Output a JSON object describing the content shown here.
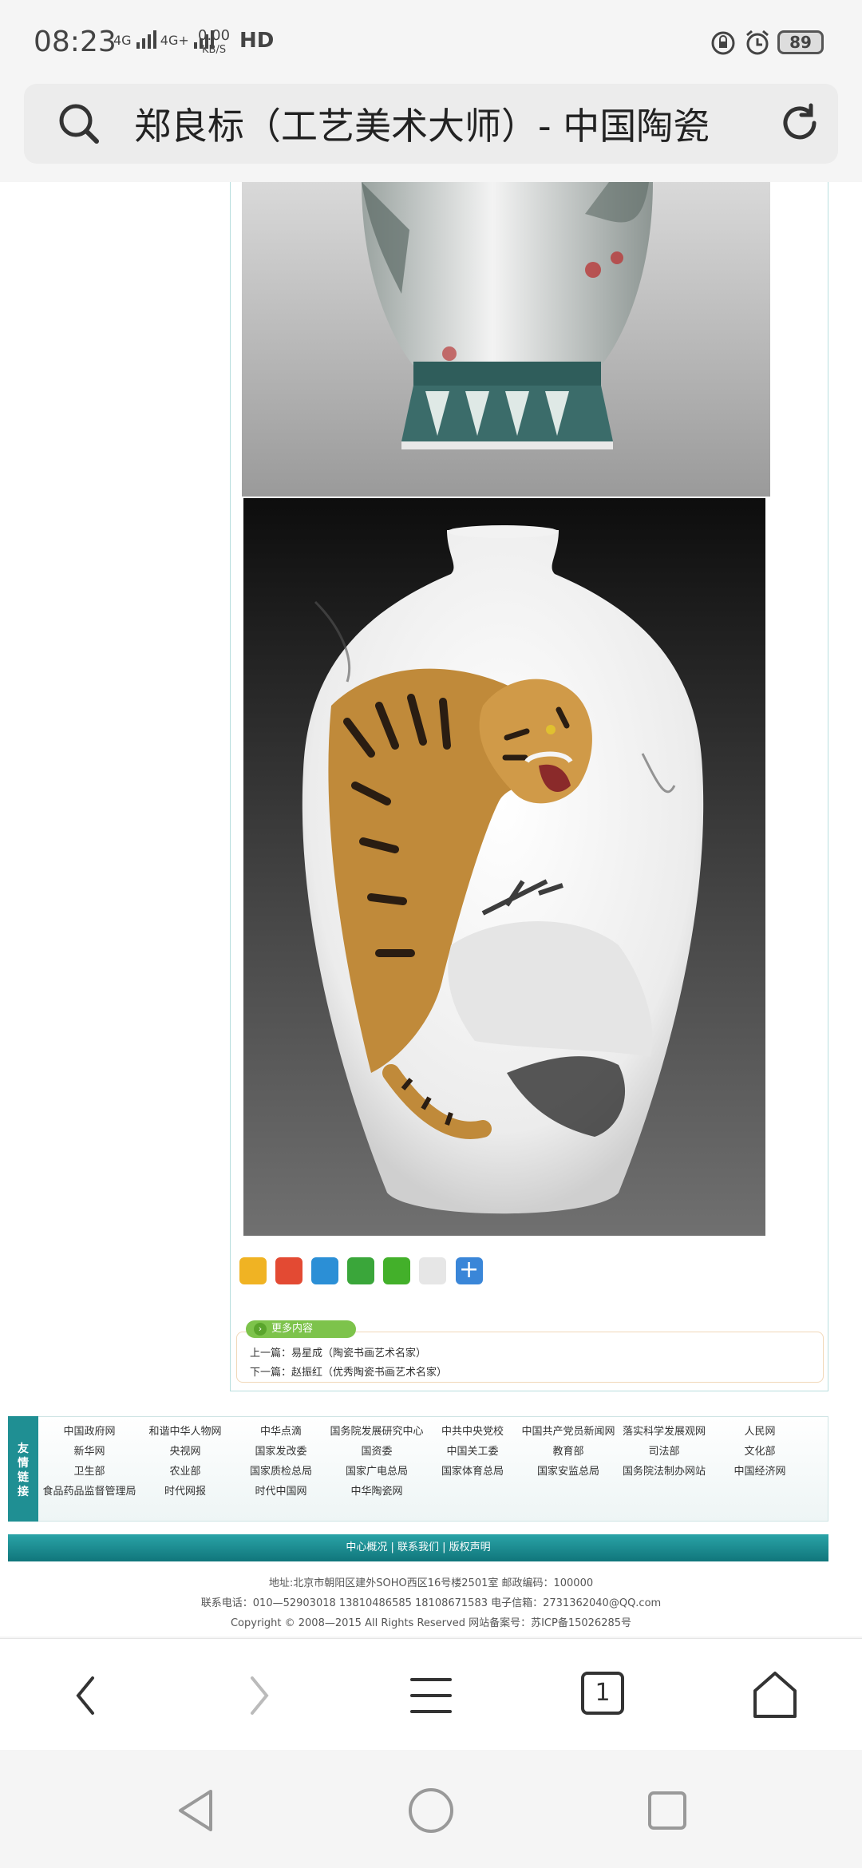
{
  "status": {
    "time": "08:23",
    "net1": "4G",
    "net2": "4G+",
    "speed": "0.00",
    "speed_unit": "KB/S",
    "hd": "HD",
    "battery": "89"
  },
  "urlbar": {
    "title": "郑良标（工艺美术大师）- 中国陶瓷"
  },
  "article": {
    "more_label": "更多内容",
    "prev": "上一篇：易星成（陶瓷书画艺术名家）",
    "next": "下一篇：赵振红（优秀陶瓷书画艺术名家）"
  },
  "friend_links": {
    "tag": "友情链接",
    "rows": [
      [
        "中国政府网",
        "和谐中华人物网",
        "中华点滴",
        "国务院发展研究中心",
        "中共中央党校",
        "中国共产党员新闻网",
        "落实科学发展观网",
        "人民网"
      ],
      [
        "新华网",
        "央视网",
        "国家发改委",
        "国资委",
        "中国关工委",
        "教育部",
        "司法部",
        "文化部"
      ],
      [
        "卫生部",
        "农业部",
        "国家质检总局",
        "国家广电总局",
        "国家体育总局",
        "国家安监总局",
        "国务院法制办网站",
        "中国经济网"
      ],
      [
        "食品药品监督管理局",
        "时代网报",
        "时代中国网",
        "中华陶瓷网"
      ]
    ]
  },
  "footer": {
    "nav": "中心概况 | 联系我们 | 版权声明",
    "address": "地址:北京市朝阳区建外SOHO西区16号楼2501室 邮政编码：100000",
    "contact": "联系电话：010—52903018 13810486585 18108671583 电子信箱：2731362040@QQ.com",
    "copyright": "Copyright © 2008—2015 All Rights Reserved 网站备案号：苏ICP备15026285号"
  },
  "browser_nav": {
    "tab_count": "1"
  },
  "colors": {
    "teal": "#1f8f93",
    "green": "#7dc34b"
  }
}
